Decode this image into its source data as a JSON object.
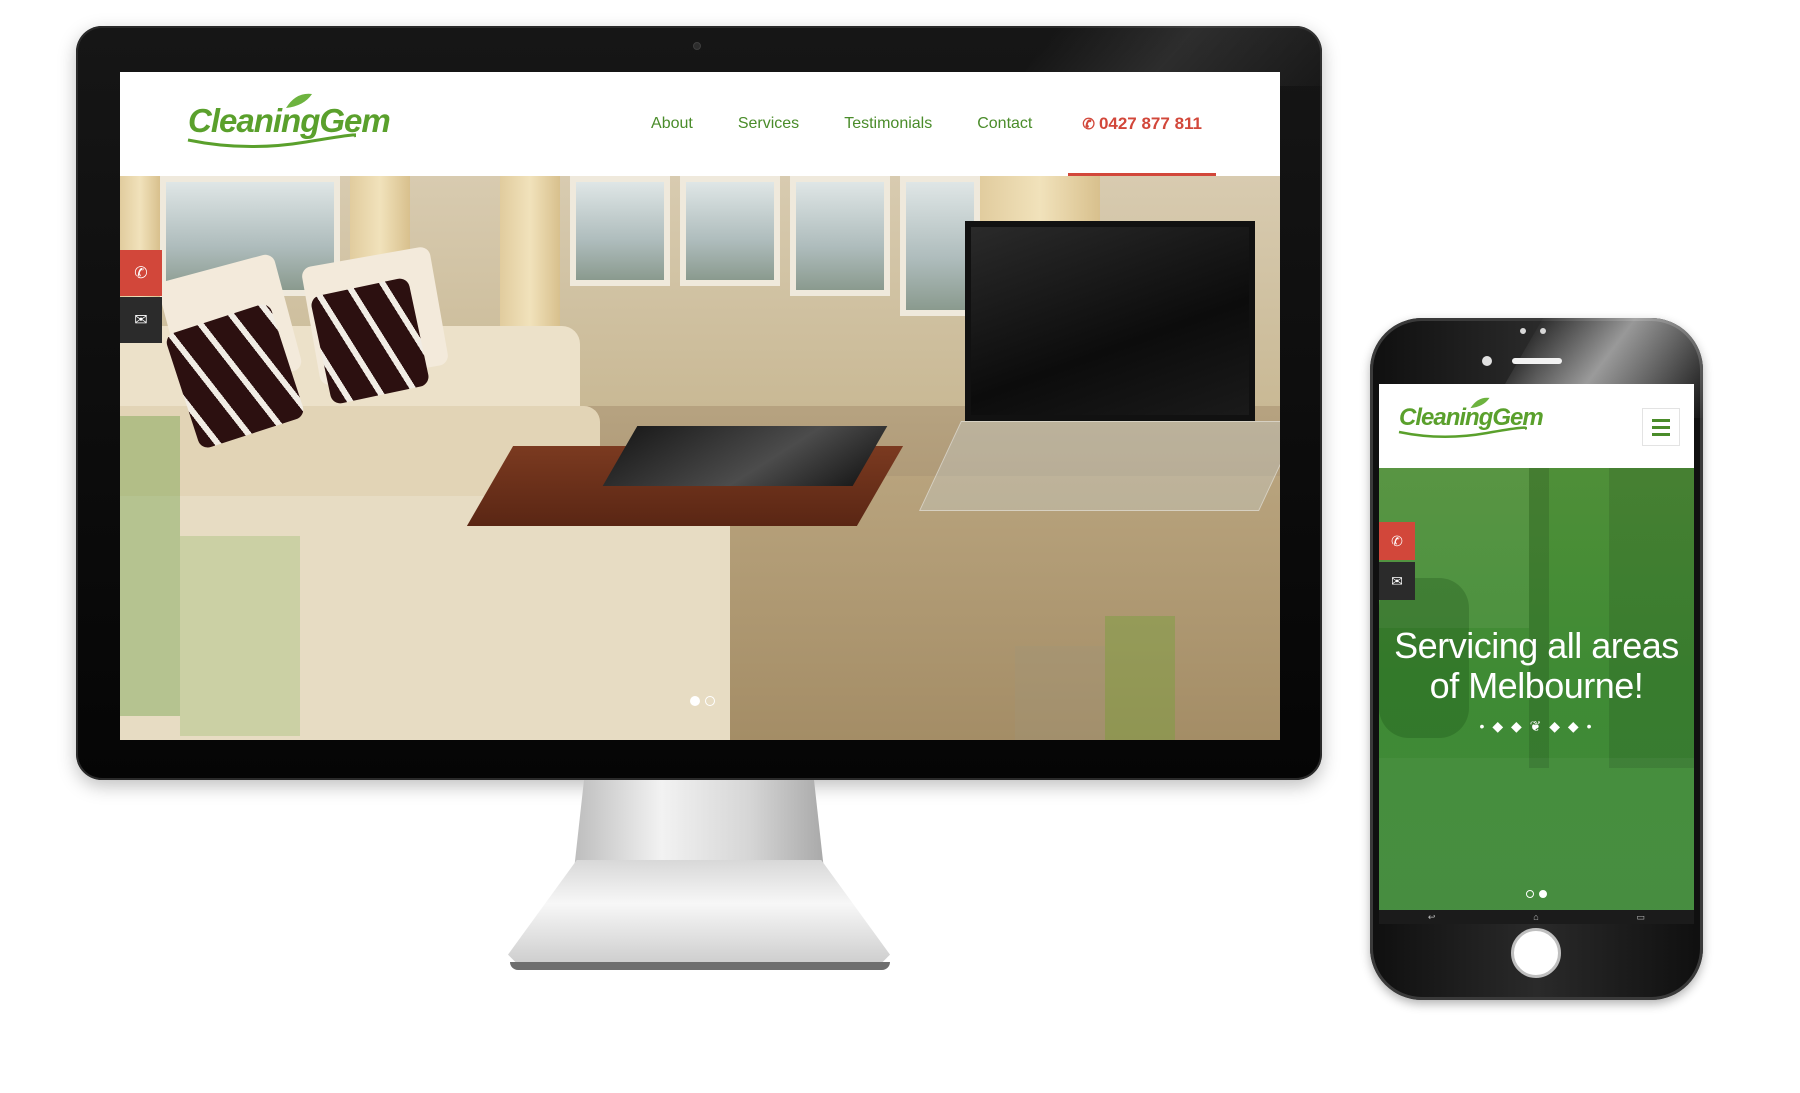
{
  "brand": {
    "logo_text": "CleaningGem",
    "green": "#5aa02c",
    "red": "#d2473a"
  },
  "desktop": {
    "nav": {
      "items": [
        "About",
        "Services",
        "Testimonials",
        "Contact"
      ],
      "phone_icon": "phone-icon",
      "phone": "0427 877 811"
    },
    "side_buttons": [
      {
        "icon": "phone-icon",
        "glyph": "✆"
      },
      {
        "icon": "envelope-icon",
        "glyph": "✉"
      }
    ],
    "slider": {
      "count": 2,
      "active": 1
    }
  },
  "mobile": {
    "menu_icon": "hamburger-menu-icon",
    "hero_text": "Servicing all areas of Melbourne!",
    "hero_line1": "Servicing all areas",
    "hero_line2": "of Melbourne!",
    "divider_ornament": "• ◆ ◆ ❦ ◆ ◆ •",
    "side_buttons": [
      {
        "icon": "phone-icon",
        "glyph": "✆"
      },
      {
        "icon": "envelope-icon",
        "glyph": "✉"
      }
    ],
    "slider": {
      "count": 2,
      "active": 2
    },
    "android_nav": [
      "↩",
      "⌂",
      "▭"
    ]
  }
}
